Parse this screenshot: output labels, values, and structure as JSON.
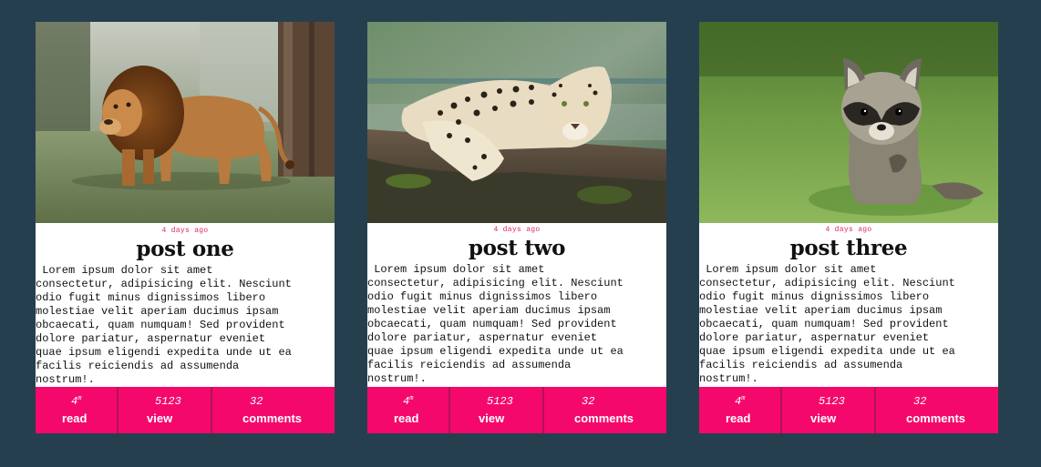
{
  "posts": [
    {
      "image": "lion-photo",
      "date": "4 days ago",
      "title": "post one",
      "body": " Lorem ipsum dolor sit amet\nconsectetur, adipisicing elit. Nesciunt\nodio fugit minus dignissimos libero\nmolestiae velit aperiam ducimus ipsam\nobcaecati, quam numquam! Sed provident\ndolore pariatur, aspernatur eveniet\nquae ipsum eligendi expedita unde ut ea\nfacilis reiciendis ad assumenda\nnostrum!.",
      "read": {
        "value": "4",
        "unit": "m",
        "label": "read"
      },
      "views": {
        "value": "5123",
        "label": "view"
      },
      "comments": {
        "value": "32",
        "label": "comments"
      }
    },
    {
      "image": "leopard-photo",
      "date": "4 days ago",
      "title": "post two",
      "body": " Lorem ipsum dolor sit amet\nconsectetur, adipisicing elit. Nesciunt\nodio fugit minus dignissimos libero\nmolestiae velit aperiam ducimus ipsam\nobcaecati, quam numquam! Sed provident\ndolore pariatur, aspernatur eveniet\nquae ipsum eligendi expedita unde ut ea\nfacilis reiciendis ad assumenda\nnostrum!.",
      "read": {
        "value": "4",
        "unit": "m",
        "label": "read"
      },
      "views": {
        "value": "5123",
        "label": "view"
      },
      "comments": {
        "value": "32",
        "label": "comments"
      }
    },
    {
      "image": "raccoon-photo",
      "date": "4 days ago",
      "title": "post three",
      "body": " Lorem ipsum dolor sit amet\nconsectetur, adipisicing elit. Nesciunt\nodio fugit minus dignissimos libero\nmolestiae velit aperiam ducimus ipsam\nobcaecati, quam numquam! Sed provident\ndolore pariatur, aspernatur eveniet\nquae ipsum eligendi expedita unde ut ea\nfacilis reiciendis ad assumenda\nnostrum!.",
      "read": {
        "value": "4",
        "unit": "m",
        "label": "read"
      },
      "views": {
        "value": "5123",
        "label": "view"
      },
      "comments": {
        "value": "32",
        "label": "comments"
      }
    }
  ],
  "colors": {
    "background": "#263f4f",
    "accent": "#f5086c",
    "date": "#e0246e"
  }
}
